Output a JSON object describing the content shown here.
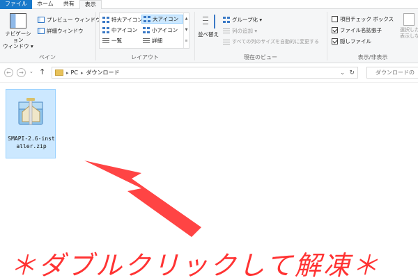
{
  "tabs": [
    {
      "label": "ファイル",
      "kind": "file"
    },
    {
      "label": "ホーム",
      "kind": "normal"
    },
    {
      "label": "共有",
      "kind": "normal"
    },
    {
      "label": "表示",
      "kind": "active"
    }
  ],
  "ribbon": {
    "pane": {
      "nav_pane_label": "ナビゲーション\nウィンドウ ▾",
      "preview_pane": "プレビュー ウィンドウ",
      "details_pane": "詳細ウィンドウ",
      "group_label": "ペイン"
    },
    "layout": {
      "items": [
        "特大アイコン",
        "大アイコン",
        "中アイコン",
        "小アイコン",
        "一覧",
        "詳細"
      ],
      "selected": "大アイコン",
      "group_label": "レイアウト"
    },
    "current_view": {
      "sort_label": "並べ替え",
      "group_by": "グループ化 ▾",
      "add_columns": "列の追加 ▾",
      "fit_columns": "すべての列のサイズを自動的に変更する",
      "group_label": "現在のビュー"
    },
    "show_hide": {
      "item_checkboxes": {
        "label": "項目チェック ボックス",
        "checked": false
      },
      "file_extensions": {
        "label": "ファイル名拡張子",
        "checked": true
      },
      "hidden_items": {
        "label": "隠しファイル",
        "checked": true
      },
      "hide_selected": "選択した項\n表示しな",
      "group_label": "表示/非表示"
    }
  },
  "address": {
    "back": "←",
    "forward": "→",
    "up": "↑",
    "crumbs": [
      "PC",
      "ダウンロード"
    ],
    "dropdown": "⌄",
    "refresh": "↻",
    "search_placeholder": "ダウンロードの"
  },
  "files": [
    {
      "name": "SMAPI-2.6-installer.zip",
      "selected": true
    }
  ],
  "annotation": {
    "text": "＊ダブルクリックして解凍＊",
    "color": "#ff3333"
  },
  "colors": {
    "file_tab": "#1979ca",
    "selection": "#cce8ff",
    "selection_border": "#99d1ff"
  }
}
